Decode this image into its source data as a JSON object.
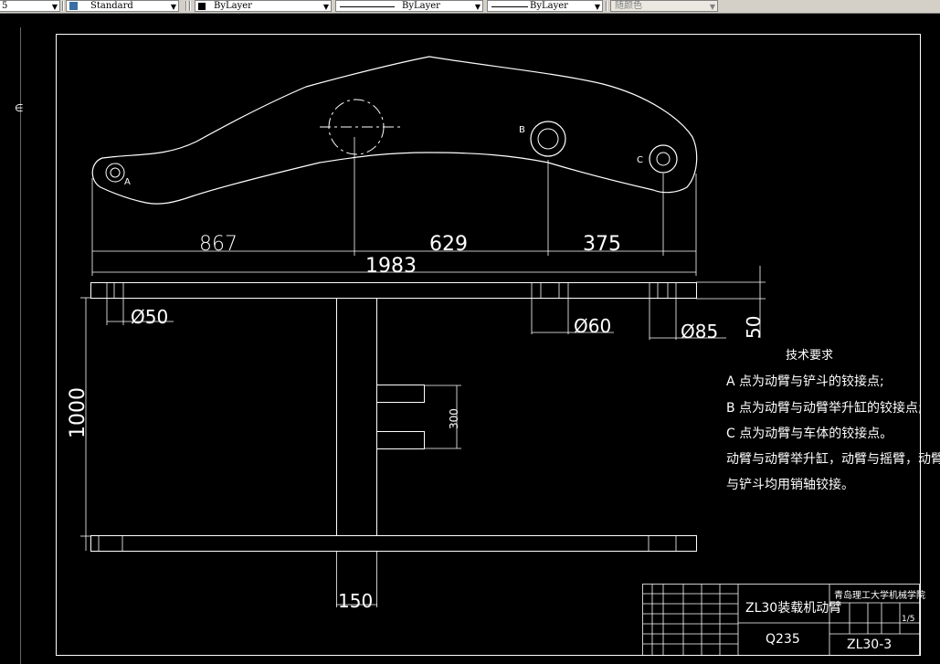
{
  "toolbar": {
    "textstyle_prefix": "5",
    "textstyle": "Standard",
    "color": "ByLayer",
    "linetype": "ByLayer",
    "lineweight": "ByLayer",
    "plotstyle": "随颜色",
    "arrow": "▼"
  },
  "drawing": {
    "labels": {
      "a": "A",
      "b": "B",
      "c": "C"
    },
    "dims": {
      "d867": "867",
      "d629": "629",
      "d375": "375",
      "d1983": "1983",
      "phi50": "Ø50",
      "phi60": "Ø60",
      "phi85": "Ø85",
      "d50": "50",
      "d1000": "1000",
      "d300": "300",
      "d150": "150"
    },
    "notes": {
      "title": "技术要求",
      "line1": "A 点为动臂与铲斗的铰接点;",
      "line2": "B 点为动臂与动臂举升缸的铰接点;",
      "line3": "C 点为动臂与车体的铰接点。",
      "line4": "动臂与动臂举升缸，动臂与摇臂，动臂",
      "line5": "与铲斗均用销轴铰接。"
    },
    "titleblock": {
      "name": "ZL30装载机动臂",
      "school": "青岛理工大学机械学院",
      "material": "Q235",
      "code": "ZL30-3",
      "scale": "1/5"
    }
  }
}
